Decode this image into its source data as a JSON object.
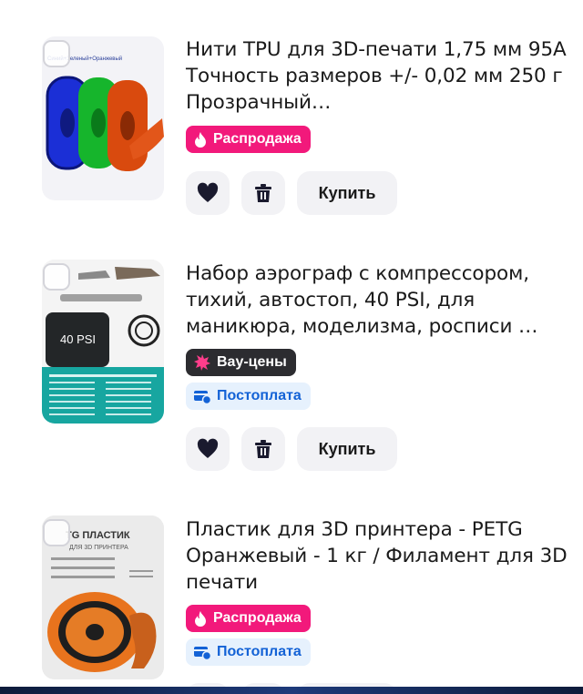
{
  "items": [
    {
      "title": "Нити TPU для 3D-печати 1,75 мм 95A Точность размеров +/- 0,02 мм 250 г Прозрачный…",
      "badges": [
        {
          "label": "Распродажа",
          "kind": "sale",
          "icon": "fire-icon"
        }
      ],
      "image_caption": "Синий+Зеленый+Оранжевый",
      "buy_label": "Купить"
    },
    {
      "title": "Набор аэрограф с компрессором, тихий, автостоп, 40 PSI, для маникюра, моделизма, росписи …",
      "badges": [
        {
          "label": "Вау-цены",
          "kind": "wow",
          "icon": "star-burst-icon"
        },
        {
          "label": "Постоплата",
          "kind": "post",
          "icon": "card-clock-icon"
        }
      ],
      "image_caption": "40 PSI",
      "buy_label": "Купить"
    },
    {
      "title": "Пластик для 3D принтера - PETG Оранжевый - 1 кг / Филамент для 3D печати",
      "badges": [
        {
          "label": "Распродажа",
          "kind": "sale",
          "icon": "fire-icon"
        },
        {
          "label": "Постоплата",
          "kind": "post",
          "icon": "card-clock-icon"
        }
      ],
      "image_caption": "TG ПЛАСТИК",
      "image_subcaption": "ДЛЯ 3D ПРИНТЕРА",
      "buy_label": "Купить"
    }
  ],
  "colors": {
    "sale": "#f2197b",
    "wow": "#2c2c30",
    "post_bg": "#e6f1fd",
    "post_text": "#1362d6",
    "button_bg": "#f2f2f5"
  }
}
